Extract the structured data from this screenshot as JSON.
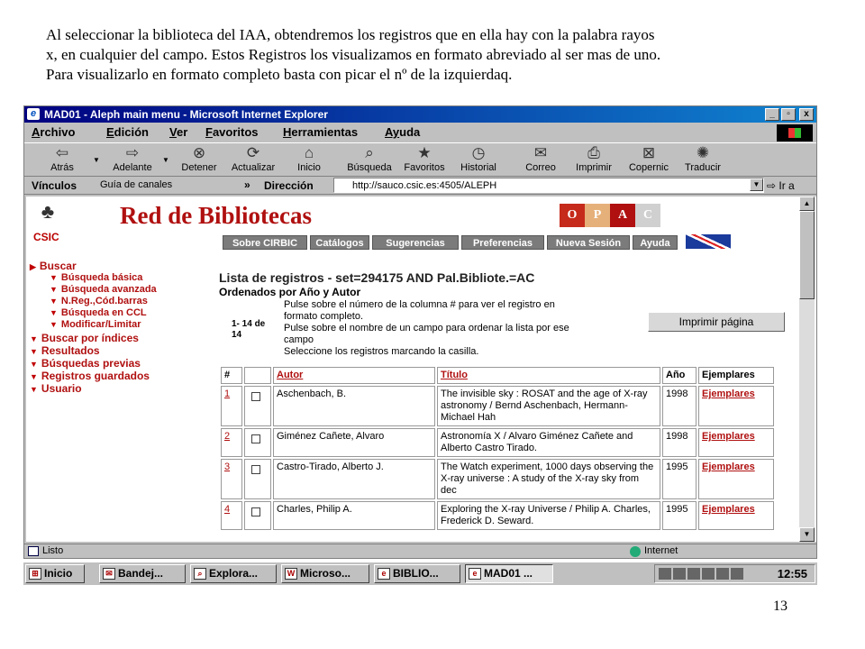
{
  "document": {
    "paragraph_lines": [
      "Al seleccionar la biblioteca del  IAA, obtendremos los  registros que  en ella hay con la palabra rayos",
      "x, en cualquier  del campo. Estos Registros los visualizamos en formato abreviado al ser mas de uno.",
      "Para visualizarlo en formato completo basta con picar el nº de la izquierdaq."
    ],
    "page_number": "13"
  },
  "window": {
    "title": "MAD01 - Aleph main menu - Microsoft Internet Explorer",
    "buttons": {
      "minimize": "_",
      "restore": "▫",
      "close": "x"
    }
  },
  "menubar": {
    "items": [
      {
        "ul": "A",
        "rest": "rchivo"
      },
      {
        "ul": "E",
        "rest": "dición"
      },
      {
        "ul": "V",
        "rest": "er"
      },
      {
        "ul": "F",
        "rest": "avoritos"
      },
      {
        "ul": "H",
        "rest": "erramientas"
      },
      {
        "ul": "Ay",
        "rest": "uda"
      }
    ]
  },
  "toolbar": {
    "buttons": [
      {
        "label": "Atrás",
        "icon": "back-arrow-icon",
        "glyph": "⇦"
      },
      {
        "label": "Adelante",
        "icon": "forward-arrow-icon",
        "glyph": "⇨"
      },
      {
        "label": "Detener",
        "icon": "stop-icon",
        "glyph": "⊗"
      },
      {
        "label": "Actualizar",
        "icon": "refresh-icon",
        "glyph": "⟳"
      },
      {
        "label": "Inicio",
        "icon": "home-icon",
        "glyph": "⌂"
      },
      {
        "label": "Búsqueda",
        "icon": "search-icon",
        "glyph": "⌕"
      },
      {
        "label": "Favoritos",
        "icon": "favorites-icon",
        "glyph": "★"
      },
      {
        "label": "Historial",
        "icon": "history-icon",
        "glyph": "◷"
      },
      {
        "label": "Correo",
        "icon": "mail-icon",
        "glyph": "✉"
      },
      {
        "label": "Imprimir",
        "icon": "print-icon",
        "glyph": "⎙"
      },
      {
        "label": "Copernic",
        "icon": "copernic-icon",
        "glyph": "⊠"
      },
      {
        "label": "Traducir",
        "icon": "translate-icon",
        "glyph": "✺"
      }
    ]
  },
  "addressbar": {
    "links_label": "Vínculos",
    "channel_guide": "Guía de canales",
    "more": "»",
    "address_label": "Dirección",
    "url": "http://sauco.csic.es:4505/ALEPH",
    "go_label": "Ir a"
  },
  "site": {
    "logo_text": "CSIC",
    "brand": "Red de Bibliotecas",
    "opac_letters": [
      "O",
      "P",
      "A",
      "C"
    ],
    "opac_colors": [
      "#c62a1a",
      "#e6b07a",
      "#b01010",
      "#d0d0d0"
    ],
    "nav_buttons": [
      "Sobre CIRBIC",
      "Catálogos",
      "Sugerencias",
      "Preferencias",
      "Nueva Sesión",
      "Ayuda"
    ]
  },
  "sidebar": {
    "items": [
      {
        "label": "Buscar",
        "level": 0,
        "marker": "▶"
      },
      {
        "label": "Búsqueda básica",
        "level": 1,
        "marker": "▼"
      },
      {
        "label": "Búsqueda avanzada",
        "level": 1,
        "marker": "▼"
      },
      {
        "label": "N.Reg.,Cód.barras",
        "level": 1,
        "marker": "▼"
      },
      {
        "label": "Búsqueda en CCL",
        "level": 1,
        "marker": "▼"
      },
      {
        "label": "Modificar/Limitar",
        "level": 1,
        "marker": "▼"
      },
      {
        "label": "Buscar por índices",
        "level": 0,
        "marker": "▼"
      },
      {
        "label": "Resultados",
        "level": 0,
        "marker": "▼"
      },
      {
        "label": "Búsquedas previas",
        "level": 0,
        "marker": "▼"
      },
      {
        "label": "Registros guardados",
        "level": 0,
        "marker": "▼"
      },
      {
        "label": "Usuario",
        "level": 0,
        "marker": "▼"
      }
    ]
  },
  "results": {
    "title": "Lista de registros - set=294175 AND Pal.Bibliote.=AC",
    "subtitle": "Ordenados por Año y Autor",
    "instructions": [
      "Pulse sobre el número de la columna # para ver el registro en",
      "formato completo.",
      "Pulse sobre el nombre de un campo para ordenar la lista por ese",
      "campo",
      "Seleccione los registros marcando la casilla."
    ],
    "count_lines": [
      "1- 14 de",
      "14"
    ],
    "print_button": "Imprimir página",
    "columns": [
      "#",
      "",
      "Autor",
      "Título",
      "Año",
      "Ejemplares"
    ],
    "rows": [
      {
        "num": "1",
        "author": "Aschenbach, B.",
        "title": "The invisible sky : ROSAT and the age of X-ray astronomy / Bernd Aschenbach, Hermann-Michael Hah",
        "year": "1998",
        "copies": "Ejemplares"
      },
      {
        "num": "2",
        "author": "Giménez Cañete, Alvaro",
        "title": "Astronomía X / Alvaro Giménez Cañete and Alberto Castro Tirado.",
        "year": "1998",
        "copies": "Ejemplares"
      },
      {
        "num": "3",
        "author": "Castro-Tirado, Alberto J.",
        "title": "The Watch experiment, 1000 days observing the X-ray universe : A study of the X-ray sky from dec",
        "year": "1995",
        "copies": "Ejemplares"
      },
      {
        "num": "4",
        "author": "Charles, Philip A.",
        "title": "Exploring the X-ray Universe / Philip A. Charles, Frederick D. Seward.",
        "year": "1995",
        "copies": "Ejemplares"
      }
    ]
  },
  "statusbar": {
    "left": "Listo",
    "zone": "Internet"
  },
  "taskbar": {
    "start": "Inicio",
    "tasks": [
      "Bandej...",
      "Explora...",
      "Microso...",
      "BIBLIO...",
      "MAD01 ..."
    ],
    "clock": "12:55"
  }
}
